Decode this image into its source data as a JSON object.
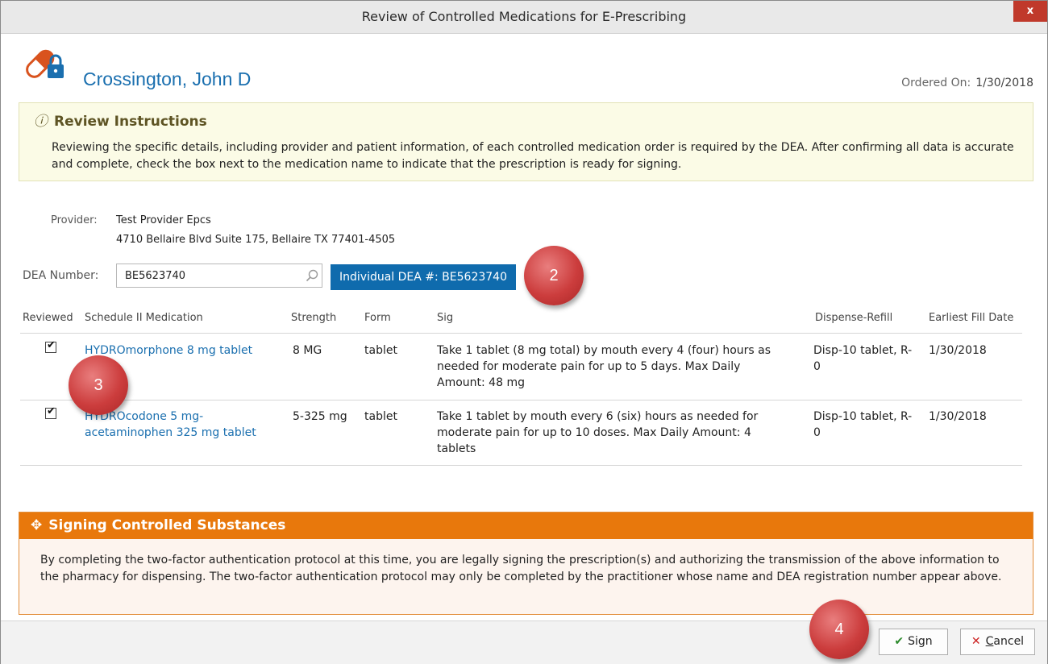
{
  "window": {
    "title": "Review of Controlled Medications for E-Prescribing",
    "close": "x"
  },
  "header": {
    "patient_name": "Crossington, John D",
    "ordered_label": "Ordered On:",
    "ordered_date": "1/30/2018"
  },
  "instructions": {
    "icon": "ⓘ",
    "title": "Review Instructions",
    "text": "Reviewing the specific details, including provider and patient information, of each controlled medication order is required by the DEA. After confirming all data is accurate and complete, check the box next to the medication name to indicate that the prescription is ready for signing."
  },
  "provider": {
    "label": "Provider:",
    "name": "Test Provider Epcs",
    "address": "4710 Bellaire Blvd Suite 175, Bellaire TX 77401-4505"
  },
  "dea": {
    "label": "DEA Number:",
    "value": "BE5623740",
    "badge": "Individual DEA #: BE5623740"
  },
  "table": {
    "headers": {
      "reviewed": "Reviewed",
      "medication": "Schedule II Medication",
      "strength": "Strength",
      "form": "Form",
      "sig": "Sig",
      "dispense": "Dispense-Refill",
      "fill": "Earliest Fill Date"
    },
    "rows": [
      {
        "checked": "✔",
        "medication": "HYDROmorphone 8 mg tablet",
        "strength": "8 MG",
        "form": "tablet",
        "sig": "Take 1 tablet (8 mg total) by mouth every 4 (four) hours as needed for moderate pain for up to 5 days. Max Daily Amount: 48 mg",
        "dispense": "Disp-10 tablet, R-0",
        "fill": "1/30/2018"
      },
      {
        "checked": "✔",
        "medication": "HYDROcodone 5 mg-acetaminophen 325 mg tablet",
        "strength": "5-325 mg",
        "form": "tablet",
        "sig": "Take 1 tablet by mouth every 6 (six) hours as needed for moderate pain for up to 10 doses. Max Daily Amount: 4 tablets",
        "dispense": "Disp-10 tablet, R-0",
        "fill": "1/30/2018"
      }
    ]
  },
  "signing": {
    "icon": "✥",
    "title": "Signing Controlled Substances",
    "text": "By completing the two-factor authentication protocol at this time, you are legally signing the prescription(s) and authorizing the transmission of the above information to the pharmacy for dispensing. The two-factor authentication protocol may only be completed by the practitioner whose name and DEA registration number appear above."
  },
  "buttons": {
    "sign": "Sign",
    "cancel_first": "C",
    "cancel_rest": "ancel"
  },
  "callouts": [
    "2",
    "3",
    "4"
  ],
  "colors": {
    "accent": "#0f6bad",
    "link": "#1a6faf",
    "warning": "#e8780c",
    "callout": "#cc3d3d"
  }
}
